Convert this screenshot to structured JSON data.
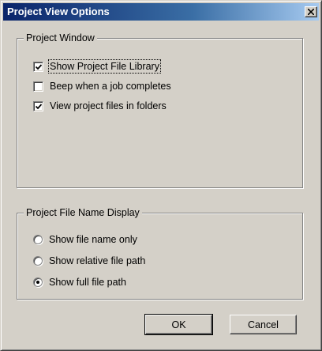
{
  "window": {
    "title": "Project View Options"
  },
  "project_window": {
    "legend": "Project Window",
    "options": [
      {
        "label": "Show Project File Library",
        "checked": true
      },
      {
        "label": "Beep when a job completes",
        "checked": false
      },
      {
        "label": "View project files in folders",
        "checked": true
      }
    ]
  },
  "name_display": {
    "legend": "Project File Name Display",
    "options": [
      {
        "label": "Show file name only",
        "selected": false
      },
      {
        "label": "Show relative file path",
        "selected": false
      },
      {
        "label": "Show full file path",
        "selected": true
      }
    ]
  },
  "buttons": {
    "ok": "OK",
    "cancel": "Cancel"
  },
  "icons": {
    "close": "close-icon",
    "check": "checkmark-icon"
  }
}
